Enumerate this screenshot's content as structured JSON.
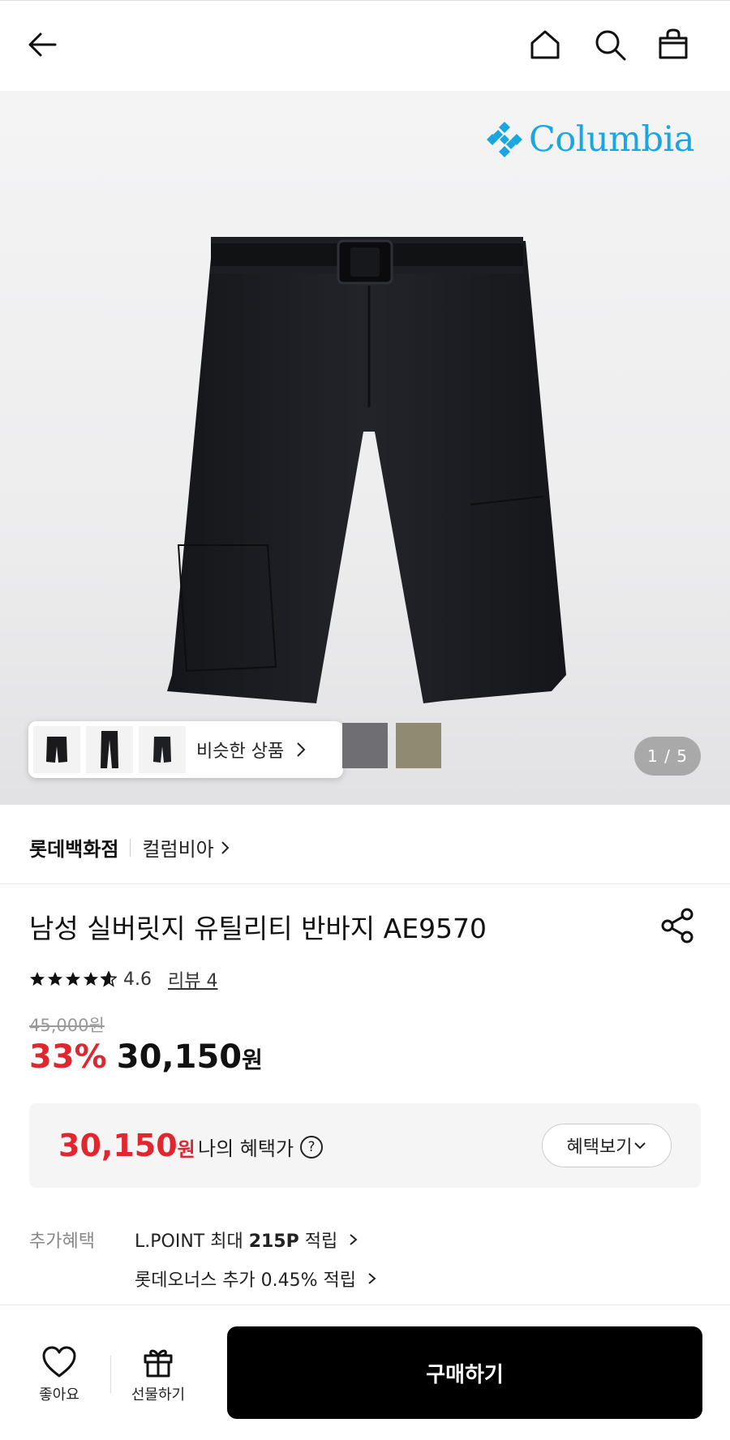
{
  "header": {
    "back_icon": "arrow-left-icon",
    "home_icon": "home-icon",
    "search_icon": "search-icon",
    "cart_icon": "shopping-bag-icon"
  },
  "gallery": {
    "brand_logo_text": "Columbia",
    "brand_logo_color": "#1aa7e0",
    "similar_label": "비슷한 상품",
    "swatch_colors": [
      "#6f6e72",
      "#8e8b72"
    ],
    "counter": "1 / 5"
  },
  "seller": {
    "store": "롯데백화점",
    "brand": "컬럼비아"
  },
  "product": {
    "title": "남성 실버릿지 유틸리티 반바지 AE9570",
    "rating": 4.6,
    "rating_text": "4.6",
    "review_link": "리뷰 4",
    "original_price": "45,000원",
    "discount": "33%",
    "sale_price": "30,150",
    "sale_unit": "원"
  },
  "benefit": {
    "price": "30,150",
    "unit": "원",
    "label": "나의 혜택가",
    "help": "?",
    "button": "혜택보기"
  },
  "extra": {
    "label": "추가혜택",
    "line1_prefix": "L.POINT 최대 ",
    "line1_bold": "215P",
    "line1_suffix": " 적립",
    "line2": "롯데오너스 추가 0.45% 적립"
  },
  "bottom": {
    "like_label": "좋아요",
    "gift_label": "선물하기",
    "buy_label": "구매하기"
  },
  "colors": {
    "accent_red": "#e0272f",
    "buy_button": "#000000"
  }
}
